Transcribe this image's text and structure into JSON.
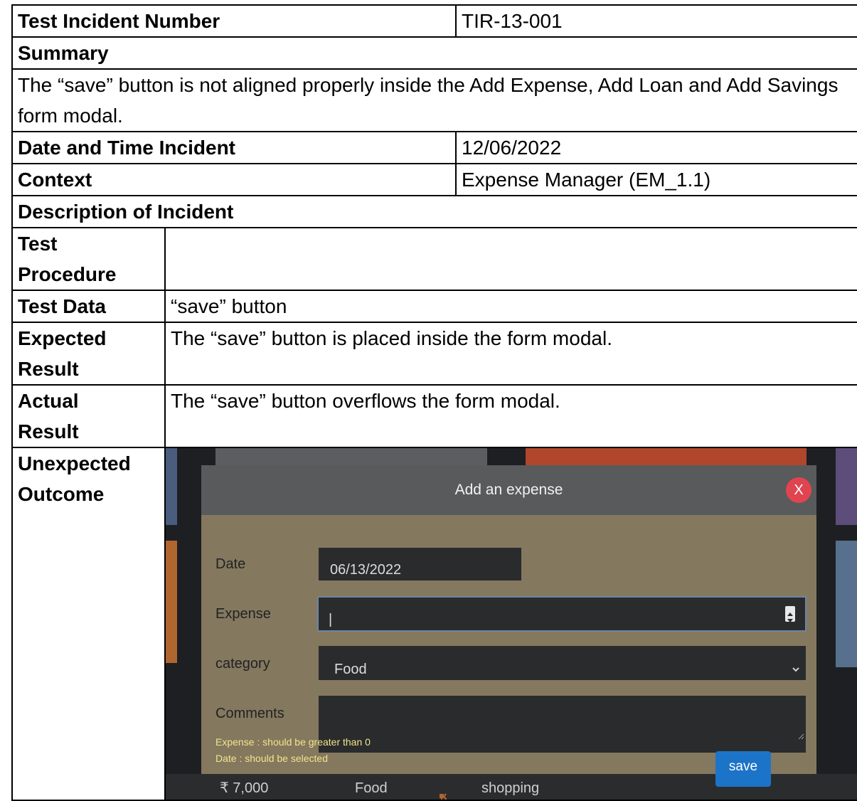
{
  "rows": {
    "test_incident_number": {
      "label": "Test Incident Number",
      "value": "TIR-13-001"
    },
    "summary": {
      "label": "Summary",
      "text": "The “save” button is not aligned properly inside the Add Expense, Add Loan and Add Savings form modal."
    },
    "date_time": {
      "label": "Date and Time Incident",
      "value": "12/06/2022"
    },
    "context": {
      "label": "Context",
      "value": "Expense Manager (EM_1.1)"
    },
    "description": {
      "label": "Description of Incident"
    },
    "test_procedure": {
      "label_line1": "Test",
      "label_line2": "Procedure",
      "value": ""
    },
    "test_data": {
      "label": "Test Data",
      "value": "“save” button"
    },
    "expected_result": {
      "label_line1": "Expected",
      "label_line2": "Result",
      "value": "The “save” button is placed inside the form modal."
    },
    "actual_result": {
      "label_line1": "Actual",
      "label_line2": "Result",
      "value": "The “save” button overflows the form modal."
    },
    "unexpected_outcome": {
      "label_line1": "Unexpected",
      "label_line2": "Outcome"
    }
  },
  "screenshot": {
    "modal_title": "Add an expense",
    "close_label": "X",
    "fields": {
      "date_label": "Date",
      "date_value": "06/13/2022",
      "expense_label": "Expense",
      "expense_value": "|",
      "category_label": "category",
      "category_value": "Food",
      "comments_label": "Comments"
    },
    "warnings": {
      "expense": "Expense : should be greater than 0",
      "date": "Date : should be selected"
    },
    "save_label": "save",
    "bottom_row": {
      "amount": "₹ 7,000",
      "category": "Food",
      "type": "shopping"
    },
    "colors": {
      "modal_bg": "#84785f",
      "modal_header": "#595a5c",
      "close_button": "#e0444f",
      "save_button": "#1c74c8",
      "warning_text": "#f3e48a"
    }
  }
}
